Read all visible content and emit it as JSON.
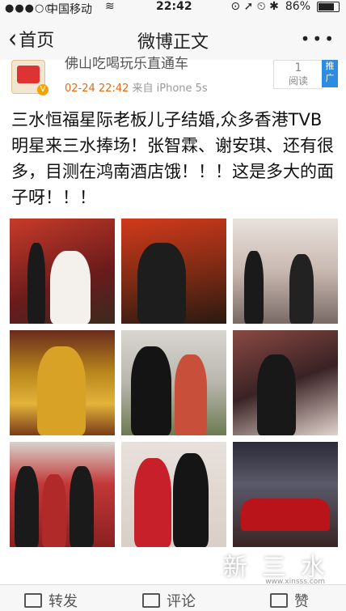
{
  "status": {
    "dots": "●●●○○",
    "carrier": "中国移动",
    "wifi": "≋",
    "time": "22:42",
    "icons": "⊙ ➚ ⏲ ✱",
    "battery": "86%",
    "battery_level": 0.86
  },
  "nav": {
    "back": "首页",
    "title": "微博正文",
    "more": "•••"
  },
  "post": {
    "username": "佛山吃喝玩乐直通车",
    "time": "02-24 22:42",
    "source": "来自 iPhone 5s",
    "reads_count": "1",
    "reads_label": "阅读",
    "promote": "推广",
    "text": "三水恒福星际老板儿子结婚,众多香港TVB明星来三水捧场！张智霖、谢安琪、还有很多，目测在鸿南酒店饿！！！这是多大的面子呀！！！"
  },
  "toolbar": {
    "repost": "转发",
    "comment": "评论",
    "like": "赞"
  },
  "watermark": {
    "text": "新三水",
    "site": "www.xinsss.com"
  }
}
